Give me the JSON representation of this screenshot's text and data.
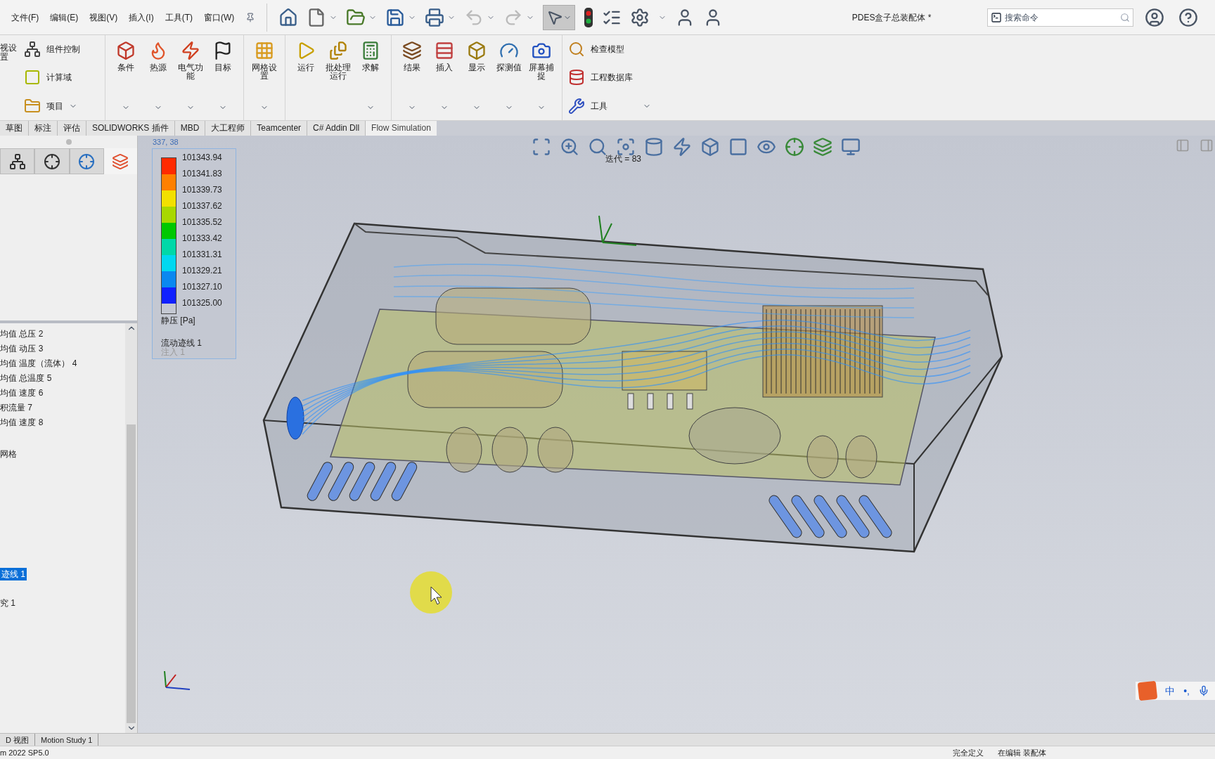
{
  "menu": [
    "文件(F)",
    "编辑(E)",
    "视图(V)",
    "插入(I)",
    "工具(T)",
    "窗口(W)"
  ],
  "window": {
    "title": "PDES盒子总装配体 *"
  },
  "search": {
    "placeholder": "搜索命令"
  },
  "ribbon": {
    "cut_label": "视设置",
    "small_left": [
      {
        "label": "组件控制",
        "dropdown": false
      },
      {
        "label": "计算域",
        "dropdown": false
      },
      {
        "label": "项目",
        "dropdown": true
      }
    ],
    "groups": [
      [
        {
          "label": "条件",
          "dropdown": true
        },
        {
          "label": "热源",
          "dropdown": true
        },
        {
          "label": "电气功能",
          "dropdown": true
        },
        {
          "label": "目标",
          "dropdown": true
        }
      ],
      [
        {
          "label": "网格设置",
          "dropdown": true
        }
      ],
      [
        {
          "label": "运行",
          "dropdown": false
        },
        {
          "label": "批处理运行",
          "dropdown": false
        },
        {
          "label": "求解",
          "dropdown": true
        }
      ],
      [
        {
          "label": "结果",
          "dropdown": true
        },
        {
          "label": "插入",
          "dropdown": true
        },
        {
          "label": "显示",
          "dropdown": true
        },
        {
          "label": "探测值",
          "dropdown": true
        },
        {
          "label": "屏幕捕捉",
          "dropdown": true
        }
      ]
    ],
    "small_right": [
      {
        "label": "检查模型",
        "dropdown": false
      },
      {
        "label": "工程数据库",
        "dropdown": false
      },
      {
        "label": "工具",
        "dropdown": true
      }
    ]
  },
  "tabs": [
    {
      "label": "草图",
      "selected": false
    },
    {
      "label": "标注",
      "selected": false
    },
    {
      "label": "评估",
      "selected": false
    },
    {
      "label": "SOLIDWORKS 插件",
      "selected": false
    },
    {
      "label": "MBD",
      "selected": false
    },
    {
      "label": "大工程师",
      "selected": false
    },
    {
      "label": "Teamcenter",
      "selected": false
    },
    {
      "label": "C# Addin Dll",
      "selected": false
    },
    {
      "label": "Flow Simulation",
      "selected": true
    }
  ],
  "panel_tabs": [
    {
      "selected": false
    },
    {
      "selected": false
    },
    {
      "selected": false
    },
    {
      "selected": true
    }
  ],
  "tree": [
    {
      "label": "均值 总压 2",
      "selected": false
    },
    {
      "label": "均值 动压 3",
      "selected": false
    },
    {
      "label": "均值 温度（流体） 4",
      "selected": false
    },
    {
      "label": "均值 总温度 5",
      "selected": false
    },
    {
      "label": "均值 速度 6",
      "selected": false
    },
    {
      "label": "积流量 7",
      "selected": false
    },
    {
      "label": "均值 速度 8",
      "selected": false
    },
    {
      "label": "网格",
      "selected": false
    },
    {
      "label": "迹线 1",
      "selected": true
    },
    {
      "label": "究 1",
      "selected": false
    }
  ],
  "viewport": {
    "coords": "337, 38",
    "iteration": "迭代 = 83"
  },
  "legend": {
    "labels": [
      "101343.94",
      "101341.83",
      "101339.73",
      "101337.62",
      "101335.52",
      "101333.42",
      "101331.31",
      "101329.21",
      "101327.10",
      "101325.00"
    ],
    "bands": [
      {
        "color": "#ff2a00"
      },
      {
        "color": "#ff8000"
      },
      {
        "color": "#f2e000"
      },
      {
        "color": "#a8d800"
      },
      {
        "color": "#00c800"
      },
      {
        "color": "#00d8a8"
      },
      {
        "color": "#00d8f0"
      },
      {
        "color": "#0a88f0"
      },
      {
        "color": "#1020ff"
      }
    ],
    "quantity": "静压 [Pa]",
    "trace": "流动迹线 1",
    "injection": "注入 1"
  },
  "ime": {
    "mode": "中",
    "punct": "•,"
  },
  "bottom_tabs": [
    "D 视图",
    "Motion Study 1"
  ],
  "status": {
    "version": "m 2022 SP5.0",
    "state": "完全定义",
    "mode": "在编辑 装配体"
  }
}
